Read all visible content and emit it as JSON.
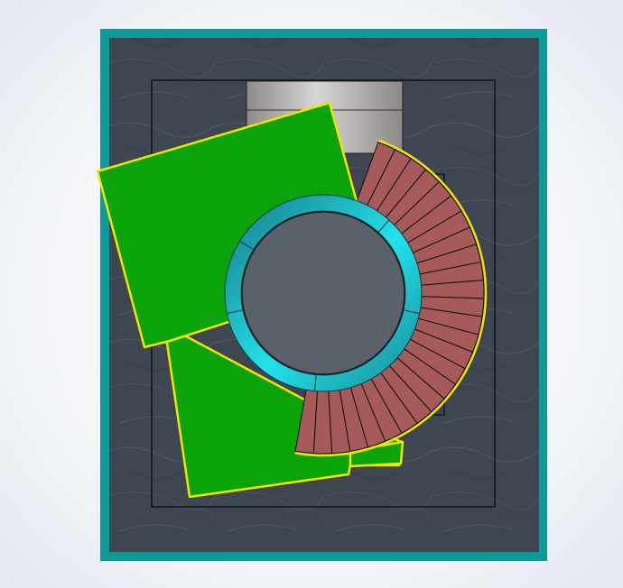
{
  "viewport": {
    "background": "#eef1f6"
  },
  "model": {
    "frame_color": "#0f9a9a",
    "floor_color": "#3e4651",
    "floor_texture": "slate",
    "outline_color": "#111111",
    "highlight_color": "#f2e400",
    "landings": [
      {
        "id": "upper-landing",
        "fill": "#0aa30a"
      },
      {
        "id": "lower-landing",
        "fill": "#0aa30a"
      }
    ],
    "treads": {
      "fill": "#a65a5a",
      "count": 26,
      "sweep_degrees": 170
    },
    "handrail_ring": {
      "fill": "#22dde3",
      "dark": "#1b8f9b"
    },
    "center_column": {
      "fill": "#5a6168"
    },
    "shaft": {
      "fill": "#bfbcbc"
    }
  }
}
